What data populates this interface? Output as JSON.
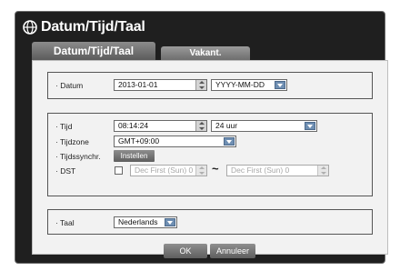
{
  "dialog": {
    "title": "Datum/Tijd/Taal",
    "icon": "globe-icon",
    "tabs": [
      {
        "label": "Datum/Tijd/Taal",
        "active": true
      },
      {
        "label": "Vakant.",
        "active": false
      }
    ]
  },
  "date_group": {
    "label": "· Datum",
    "date_value": "2013-01-01",
    "format_value": "YYYY-MM-DD"
  },
  "time_group": {
    "time_label": "· Tijd",
    "time_value": "08:14:24",
    "hour_format_value": "24 uur",
    "timezone_label": "· Tijdzone",
    "timezone_value": "GMT+09:00",
    "sync_label": "· Tijdssynchr.",
    "sync_button": "Instellen",
    "dst_label": "· DST",
    "dst_checked": false,
    "dst_start": "Dec First (Sun) 0",
    "dst_separator": "~",
    "dst_end": "Dec First (Sun) 0"
  },
  "language_group": {
    "label": "· Taal",
    "language_value": "Nederlands"
  },
  "footer": {
    "ok_label": "OK",
    "cancel_label": "Annuleer"
  },
  "colors": {
    "window_bg": "#1f1f1f",
    "panel_bg": "#f2f2f2",
    "dropdown_accent": "#6f8fb3"
  }
}
